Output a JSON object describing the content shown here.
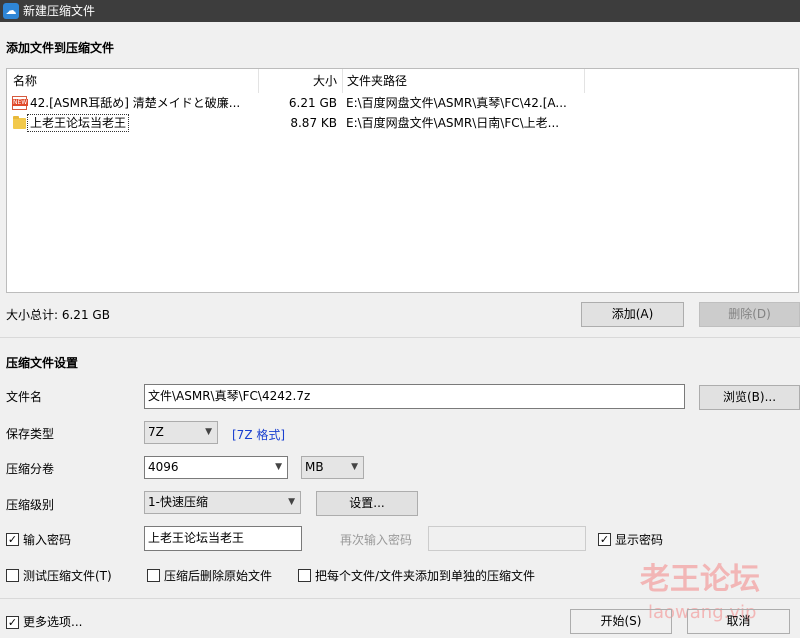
{
  "window": {
    "title": "新建压缩文件",
    "app_icon": "cloud-icon"
  },
  "add_section": {
    "title": "添加文件到压缩文件",
    "columns": {
      "name": "名称",
      "size": "大小",
      "path": "文件夹路径"
    },
    "files": [
      {
        "icon": "new-file-icon",
        "name": "42.[ASMR耳舐め] 清楚メイドと破廉...",
        "size": "6.21 GB",
        "path": "E:\\百度网盘文件\\ASMR\\真琴\\FC\\42.[A..."
      },
      {
        "icon": "folder-icon",
        "name": "上老王论坛当老王",
        "size": "8.87 KB",
        "path": "E:\\百度网盘文件\\ASMR\\日南\\FC\\上老..."
      }
    ],
    "total_label": "大小总计: 6.21 GB",
    "add_button": "添加(A)",
    "delete_button": "删除(D)"
  },
  "settings": {
    "title": "压缩文件设置",
    "filename_label": "文件名",
    "filename_value": "文件\\ASMR\\真琴\\FC\\4242.7z",
    "browse_button": "浏览(B)...",
    "type_label": "保存类型",
    "type_value": "7Z",
    "format_link": "[7Z 格式]",
    "volume_label": "压缩分卷",
    "volume_value": "4096",
    "volume_unit": "MB",
    "level_label": "压缩级别",
    "level_value": "1-快速压缩",
    "settings_button": "设置...",
    "password_checkbox": "输入密码",
    "password_checked": true,
    "password_value": "上老王论坛当老王",
    "repeat_password_label": "再次输入密码",
    "show_password_checkbox": "显示密码",
    "show_password_checked": true,
    "test_archive": "测试压缩文件(T)",
    "delete_after": "压缩后删除原始文件",
    "separate_archives": "把每个文件/文件夹添加到单独的压缩文件"
  },
  "footer": {
    "more_options": "更多选项...",
    "more_options_checked": true,
    "start_button": "开始(S)",
    "cancel_button": "取消"
  },
  "watermark": {
    "text": "老王论坛",
    "subtext": "laowang.vip"
  }
}
